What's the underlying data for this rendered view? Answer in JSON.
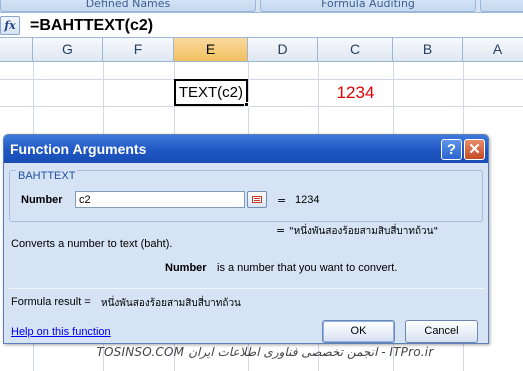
{
  "ribbon": {
    "groups": [
      "Defined Names",
      "Formula Auditing"
    ]
  },
  "formula_bar": {
    "fx_icon": "function-icon",
    "fx_label": "fx",
    "formula": "=BAHTTEXT(c2)"
  },
  "columns": [
    "G",
    "F",
    "E",
    "D",
    "C",
    "B",
    "A"
  ],
  "selected_column": "E",
  "cells": {
    "e_visible_text": "TEXT(c2)",
    "c_value": "1234",
    "c_color": "#e00000"
  },
  "dialog": {
    "title": "Function Arguments",
    "help_glyph": "?",
    "close_glyph": "✕",
    "function_name": "BAHTTEXT",
    "argument": {
      "label": "Number",
      "value": "c2",
      "equals": "=",
      "evaluated": "1234"
    },
    "result": {
      "equals": "=",
      "value": "\"หนึ่งพันสองร้อยสามสิบสี่บาทถ้วน\""
    },
    "description": "Converts a number to text (baht).",
    "argument_help": {
      "name": "Number",
      "text": "is a number that you want to convert."
    },
    "formula_result_label": "Formula result =",
    "formula_result_value": "หนึ่งพันสองร้อยสามสิบสี่บาทถ้วน",
    "help_link": "Help on this function",
    "ok_label": "OK",
    "cancel_label": "Cancel"
  },
  "watermark": "TOSINSO.COM  انجمن تخصصی فناوری اطلاعات ایران - ITPro.ir"
}
